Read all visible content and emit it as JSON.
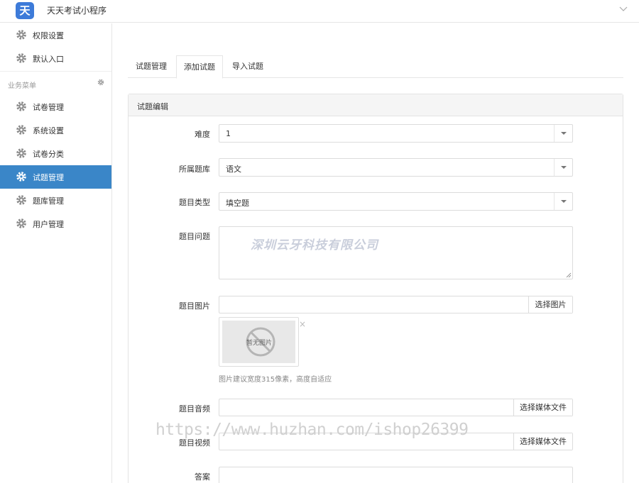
{
  "header": {
    "logo_char": "天",
    "app_title": "天天考试小程序"
  },
  "sidebar": {
    "top_items": [
      {
        "label": "权限设置"
      },
      {
        "label": "默认入口"
      }
    ],
    "section_title": "业务菜单",
    "items": [
      {
        "label": "试卷管理",
        "active": false
      },
      {
        "label": "系统设置",
        "active": false
      },
      {
        "label": "试卷分类",
        "active": false
      },
      {
        "label": "试题管理",
        "active": true
      },
      {
        "label": "题库管理",
        "active": false
      },
      {
        "label": "用户管理",
        "active": false
      }
    ]
  },
  "tabs": [
    {
      "label": "试题管理",
      "active": false
    },
    {
      "label": "添加试题",
      "active": true
    },
    {
      "label": "导入试题",
      "active": false
    }
  ],
  "panel": {
    "title": "试题编辑",
    "fields": {
      "difficulty": {
        "label": "难度",
        "value": "1"
      },
      "bank": {
        "label": "所属题库",
        "value": "语文"
      },
      "type": {
        "label": "题目类型",
        "value": "填空题"
      },
      "question": {
        "label": "题目问题",
        "value": ""
      },
      "image": {
        "label": "题目图片",
        "value": "",
        "button": "选择图片",
        "placeholder_text": "暂无图片",
        "hint": "图片建议宽度315像素，高度自适应"
      },
      "audio": {
        "label": "题目音频",
        "value": "",
        "button": "选择媒体文件"
      },
      "video": {
        "label": "题目视频",
        "value": "",
        "button": "选择媒体文件"
      },
      "answer": {
        "label": "答案",
        "value": ""
      }
    }
  },
  "watermarks": {
    "company": "深圳云牙科技有限公司",
    "url": "https://www.huzhan.com/ishop26399"
  },
  "colors": {
    "accent": "#3a86c8",
    "logo": "#3d7bd9"
  }
}
